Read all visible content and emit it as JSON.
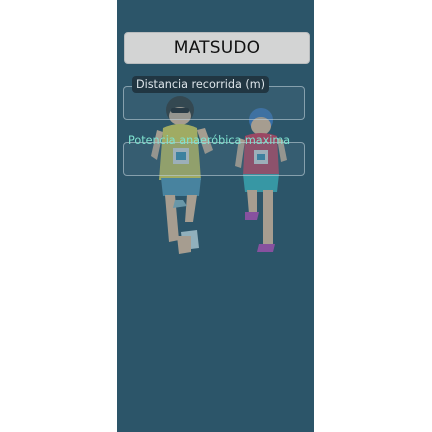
{
  "app": {
    "title_button": "MATSUDO"
  },
  "fields": {
    "distance": {
      "label": "Distancia recorrida (m)",
      "value": ""
    },
    "anaerobic_power": {
      "label": "Potencia anaeróbica maxima",
      "value": ""
    }
  },
  "colors": {
    "background": "#2c5569",
    "title_button_bg": "#d3d4d4",
    "accent_label": "#7fe3d0"
  },
  "background_image": "runners-illustration"
}
